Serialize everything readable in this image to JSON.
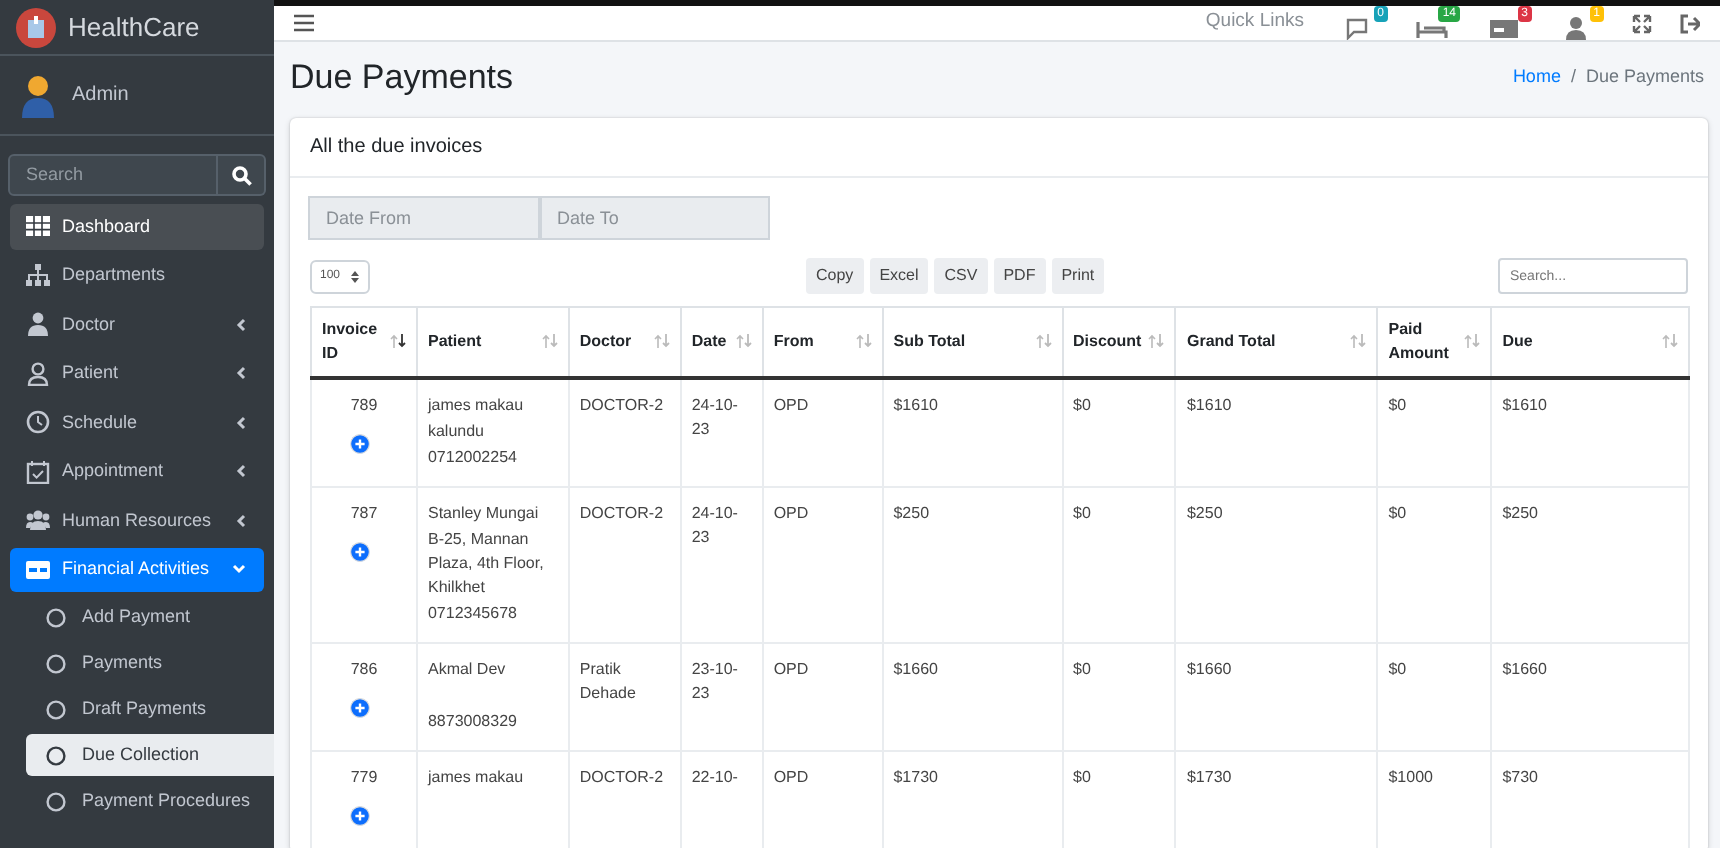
{
  "sidebar": {
    "brand": "HealthCare",
    "user": "Admin",
    "search": {
      "placeholder": "Search"
    },
    "items": [
      {
        "label": "Dashboard",
        "kind": "link",
        "hovered": true,
        "selected": false
      },
      {
        "label": "Departments",
        "kind": "link",
        "hovered": false,
        "selected": false
      },
      {
        "label": "Doctor",
        "kind": "menu",
        "hovered": false,
        "selected": false,
        "expanded": false
      },
      {
        "label": "Patient",
        "kind": "menu",
        "hovered": false,
        "selected": false,
        "expanded": false
      },
      {
        "label": "Schedule",
        "kind": "menu",
        "hovered": false,
        "selected": false,
        "expanded": false
      },
      {
        "label": "Appointment",
        "kind": "menu",
        "hovered": false,
        "selected": false,
        "expanded": false
      },
      {
        "label": "Human Resources",
        "kind": "menu",
        "hovered": false,
        "selected": false,
        "expanded": false
      },
      {
        "label": "Financial Activities",
        "kind": "menu",
        "hovered": false,
        "selected": true,
        "expanded": true,
        "children": [
          {
            "label": "Add Payment",
            "selected": false
          },
          {
            "label": "Payments",
            "selected": false
          },
          {
            "label": "Draft Payments",
            "selected": false
          },
          {
            "label": "Due Collection",
            "selected": true
          },
          {
            "label": "Payment Procedures",
            "selected": false
          }
        ]
      }
    ]
  },
  "topbar": {
    "quick_links": "Quick Links",
    "badges": [
      {
        "count": "0",
        "color": "#17a2b8"
      },
      {
        "count": "14",
        "color": "#28a745"
      },
      {
        "count": "3",
        "color": "#dc3545"
      },
      {
        "count": "1",
        "color": "#ffc107"
      }
    ]
  },
  "page": {
    "title": "Due Payments",
    "breadcrumb_separator": "/",
    "breadcrumb": [
      {
        "label": "Home",
        "selected": false
      },
      {
        "label": "Due Payments",
        "selected": true
      }
    ]
  },
  "card": {
    "title": "All the due invoices",
    "date_from": {
      "placeholder": "Date From"
    },
    "date_to": {
      "placeholder": "Date To"
    },
    "page_length": "100",
    "export_buttons": [
      "Copy",
      "Excel",
      "CSV",
      "PDF",
      "Print"
    ],
    "search": {
      "placeholder": "Search..."
    }
  },
  "table": {
    "columns": [
      {
        "label": "Invoice ID",
        "sorted": true
      },
      {
        "label": "Patient",
        "sorted": false
      },
      {
        "label": "Doctor",
        "sorted": false
      },
      {
        "label": "Date",
        "sorted": false
      },
      {
        "label": "From",
        "sorted": false
      },
      {
        "label": "Sub Total",
        "sorted": false
      },
      {
        "label": "Discount",
        "sorted": false
      },
      {
        "label": "Grand Total",
        "sorted": false
      },
      {
        "label": "Paid Amount",
        "sorted": false
      },
      {
        "label": "Due",
        "sorted": false
      }
    ],
    "rows": [
      {
        "id": "789",
        "patient": {
          "name": "james makau",
          "address": "kalundu",
          "phone": "0712002254"
        },
        "doctor": "DOCTOR-2",
        "date": "24-10-23",
        "from": "OPD",
        "sub_total": "$1610",
        "discount": "$0",
        "grand_total": "$1610",
        "paid": "$0",
        "due": "$1610"
      },
      {
        "id": "787",
        "patient": {
          "name": "Stanley Mungai",
          "address": "B-25, Mannan Plaza, 4th Floor, Khilkhet",
          "phone": "0712345678"
        },
        "doctor": "DOCTOR-2",
        "date": "24-10-23",
        "from": "OPD",
        "sub_total": "$250",
        "discount": "$0",
        "grand_total": "$250",
        "paid": "$0",
        "due": "$250"
      },
      {
        "id": "786",
        "patient": {
          "name": "Akmal Dev",
          "phone": "8873008329"
        },
        "doctor": "Pratik Dehade",
        "date": "23-10-23",
        "from": "OPD",
        "sub_total": "$1660",
        "discount": "$0",
        "grand_total": "$1660",
        "paid": "$0",
        "due": "$1660"
      },
      {
        "id": "779",
        "patient": {
          "name": "james makau"
        },
        "doctor": "DOCTOR-2",
        "date": "22-10-",
        "from": "OPD",
        "sub_total": "$1730",
        "discount": "$0",
        "grand_total": "$1730",
        "paid": "$1000",
        "due": "$730"
      }
    ]
  }
}
